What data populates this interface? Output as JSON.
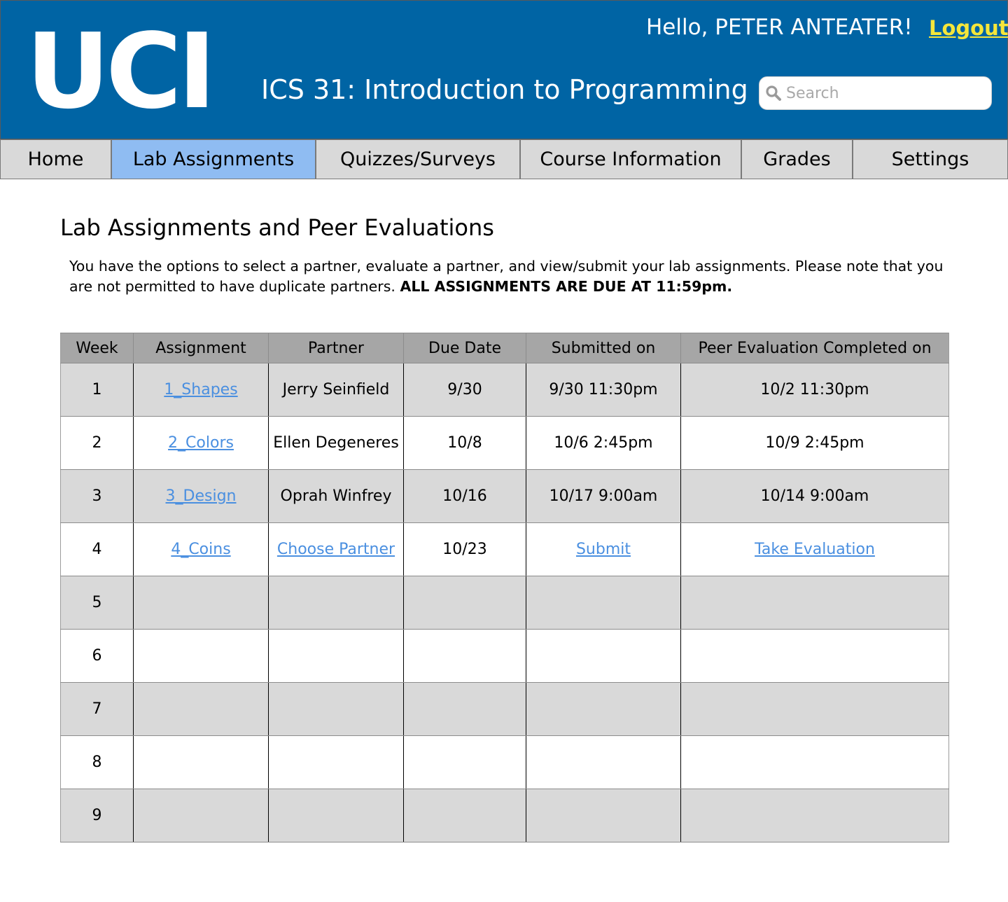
{
  "header": {
    "logo_text": "UCI",
    "course_title": "ICS 31: Introduction to Programming",
    "greeting": "Hello, PETER ANTEATER!",
    "logout_label": "Logout",
    "search_placeholder": "Search",
    "search_icon": "search-icon",
    "logout_color": "#f5e63a",
    "brand_color": "#0064a4"
  },
  "nav": {
    "active_color": "#8fbcf2",
    "items": [
      {
        "label": "Home"
      },
      {
        "label": "Lab Assignments",
        "active": true
      },
      {
        "label": "Quizzes/Surveys"
      },
      {
        "label": "Course Information"
      },
      {
        "label": "Grades"
      },
      {
        "label": "Settings"
      }
    ]
  },
  "main": {
    "title": "Lab Assignments and Peer Evaluations",
    "intro_text": "You have the options to select a partner, evaluate a partner, and view/submit your lab assignments. Please note that you are not permitted to have duplicate partners.",
    "intro_emphasis": "ALL ASSIGNMENTS ARE DUE AT 11:59pm."
  },
  "table": {
    "headers": [
      "Week",
      "Assignment",
      "Partner",
      "Due Date",
      "Submitted on",
      "Peer Evaluation Completed on"
    ],
    "rows": [
      {
        "week": "1",
        "assignment": "1_Shapes",
        "partner": "Jerry Seinfield",
        "due": "9/30",
        "submitted": "9/30 11:30pm",
        "evaluation": "10/2 11:30pm"
      },
      {
        "week": "2",
        "assignment": "2_Colors",
        "partner": "Ellen Degeneres",
        "due": "10/8",
        "submitted": "10/6 2:45pm",
        "evaluation": "10/9 2:45pm"
      },
      {
        "week": "3",
        "assignment": "3_Design",
        "partner": "Oprah Winfrey",
        "due": "10/16",
        "submitted": "10/17 9:00am",
        "evaluation": "10/14 9:00am"
      },
      {
        "week": "4",
        "assignment": "4_Coins",
        "partner": "Choose Partner",
        "due": "10/23",
        "submitted": "Submit",
        "evaluation": "Take Evaluation"
      },
      {
        "week": "5",
        "assignment": "",
        "partner": "",
        "due": "",
        "submitted": "",
        "evaluation": ""
      },
      {
        "week": "6",
        "assignment": "",
        "partner": "",
        "due": "",
        "submitted": "",
        "evaluation": ""
      },
      {
        "week": "7",
        "assignment": "",
        "partner": "",
        "due": "",
        "submitted": "",
        "evaluation": ""
      },
      {
        "week": "8",
        "assignment": "",
        "partner": "",
        "due": "",
        "submitted": "",
        "evaluation": ""
      },
      {
        "week": "9",
        "assignment": "",
        "partner": "",
        "due": "",
        "submitted": "",
        "evaluation": ""
      }
    ]
  }
}
